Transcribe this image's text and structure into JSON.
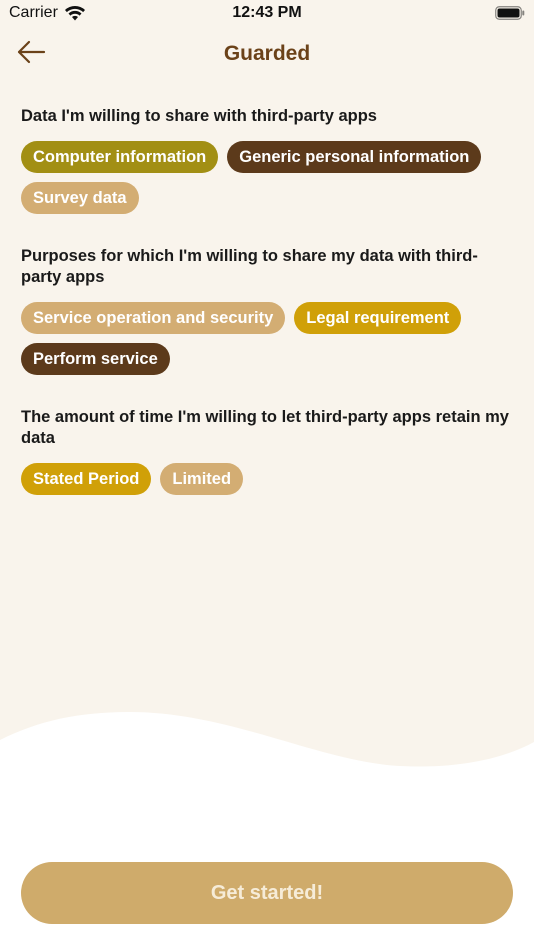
{
  "status_bar": {
    "carrier": "Carrier",
    "time": "12:43 PM",
    "icons": [
      "wifi-icon",
      "battery-icon"
    ]
  },
  "nav": {
    "title": "Guarded",
    "back_icon": "arrow-left-icon"
  },
  "sections": [
    {
      "title": "Data I'm willing to share with third-party apps",
      "chips": [
        {
          "label": "Computer information",
          "color": "#a28f14"
        },
        {
          "label": "Generic personal information",
          "color": "#5c3a1b"
        },
        {
          "label": "Survey data",
          "color": "#d3ad73"
        }
      ]
    },
    {
      "title": "Purposes for which I'm willing to share my data with third-party apps",
      "chips": [
        {
          "label": "Service operation and security",
          "color": "#d3ad73"
        },
        {
          "label": "Legal requirement",
          "color": "#d0a008"
        },
        {
          "label": "Perform service",
          "color": "#5c3a1b"
        }
      ]
    },
    {
      "title": "The amount of time I'm willing to let third-party apps retain my data",
      "chips": [
        {
          "label": "Stated Period",
          "color": "#d0a008"
        },
        {
          "label": "Limited",
          "color": "#d3ad73"
        }
      ]
    }
  ],
  "footer": {
    "button_label": "Get started!"
  },
  "colors": {
    "background": "#f9f4ec",
    "accent_brown": "#6b4219",
    "button": "#cfab6b"
  }
}
